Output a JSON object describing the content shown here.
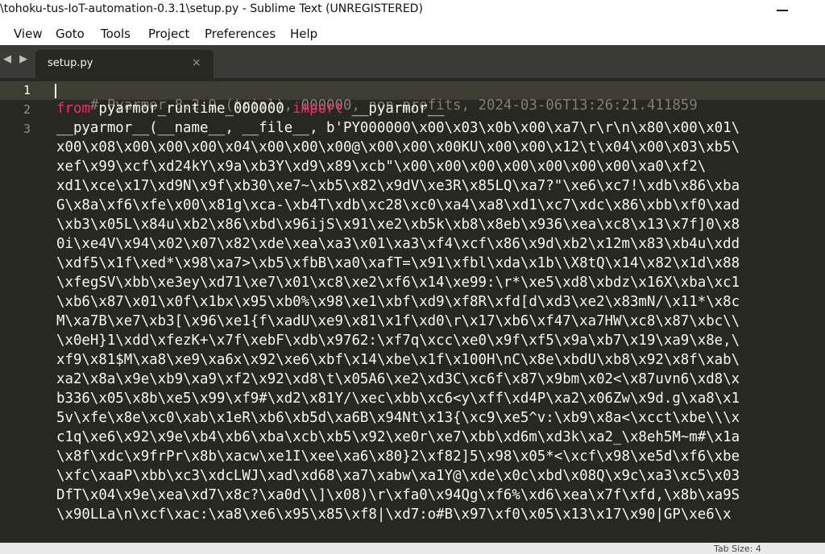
{
  "window": {
    "title": "\\tohoku-tus-IoT-automation-0.3.1\\setup.py - Sublime Text (UNREGISTERED)",
    "minimize_icon": "minimize-icon"
  },
  "menu": [
    "View",
    "Goto",
    "Tools",
    "Project",
    "Preferences",
    "Help"
  ],
  "tabs": {
    "nav_arrows": "◀ ▶",
    "active": {
      "label": "setup.py",
      "close_glyph": "×"
    }
  },
  "editor": {
    "active_line": 1,
    "line_numbers": [
      "1",
      "2",
      "3"
    ],
    "line1_comment": "# Pyarmor 8.2.9 (trial), 000000, non-profits, 2024-03-06T13:26:21.411859",
    "line2": {
      "keyword_from": "from",
      "module": " pyarmor_runtime_000000 ",
      "keyword_import": "import",
      "name": " __pyarmor__"
    },
    "code_lines": [
      "__pyarmor__(__name__, __file__, b'PY000000\\x00\\x03\\x0b\\x00\\xa7\\r\\r\\n\\x80\\x00\\x01\\",
      "x00\\x08\\x00\\x00\\x00\\x04\\x00\\x00\\x00@\\x00\\x00\\x00KU\\x00\\x00\\x12\\t\\x04\\x00\\x03\\xb5\\",
      "xef\\x99\\xcf\\xd24kY\\x9a\\xb3Y\\xd9\\x89\\xcb\"\\x00\\x00\\x00\\x00\\x00\\x00\\x00\\xa0\\xf2\\",
      "xd1\\xce\\x17\\xd9N\\x9f\\xb30\\xe7~\\xb5\\x82\\x9dV\\xe3R\\x85LQ\\xa7?\"\\xe6\\xc7!\\xdb\\x86\\xba",
      "G\\x8a\\xf6\\xfe\\x00\\x81g\\xca-\\xb4T\\xdb\\xc28\\xc0\\xa4\\xa8\\xd1\\xc7\\xdc\\x86\\xbb\\xf0\\xad",
      "\\xb3\\x05L\\x84u\\xb2\\x86\\xbd\\x96ijS\\x91\\xe2\\xb5k\\xb8\\x8eb\\x936\\xea\\xc8\\x13\\x7f]0\\x8",
      "0i\\xe4V\\x94\\x02\\x07\\x82\\xde\\xea\\xa3\\x01\\xa3\\xf4\\xcf\\x86\\x9d\\xb2\\x12m\\x83\\xb4u\\xdd",
      "\\xdf5\\x1f\\xed*\\x98\\xa7>\\xb5\\xfbB\\xa0\\xafT=\\x91\\xfbl\\xda\\x1b\\\\X8tQ\\x14\\x82\\x1d\\x88",
      "\\xfegSV\\xbb\\xe3ey\\xd71\\xe7\\x01\\xc8\\xe2\\xf6\\x14\\xe99:\\r*\\xe5\\xd8\\xbdz\\x16X\\xba\\xc1",
      "\\xb6\\x87\\x01\\x0f\\x1bx\\x95\\xb0%\\x98\\xe1\\xbf\\xd9\\xf8R\\xfd[d\\xd3\\xe2\\x83mN/\\x11*\\x8c",
      "M\\xa7B\\xe7\\xb3[\\x96\\xe1{f\\xadU\\xe9\\x81\\x1f\\xd0\\r\\x17\\xb6\\xf47\\xa7HW\\xc8\\x87\\xbc\\\\",
      "\\x0eH}1\\xdd\\xfezK+\\x7f\\xebF\\xdb\\x9762:\\xf7q\\xcc\\xe0\\x9f\\xf5\\x9a\\xb7\\x19\\xa9\\x8e,\\",
      "xf9\\x81$M\\xa8\\xe9\\xa6x\\x92\\xe6\\xbf\\x14\\xbe\\x1f\\x100H\\nC\\x8e\\xbdU\\xb8\\x92\\x8f\\xab\\",
      "xa2\\x8a\\x9e\\xb9\\xa9\\xf2\\x92\\xd8\\t\\x05A6\\xe2\\xd3C\\xc6f\\x87\\x9bm\\x02<\\x87uvn6\\xd8\\x",
      "b336\\x05\\x8b\\xe5\\x99\\xf9#\\xd2\\x81Y/\\xec\\xbb\\xc6<y\\xff\\xd4P\\xa2\\x06Zw\\x9d.g\\xa8\\x1",
      "5v\\xfe\\x8e\\xc0\\xab\\x1eR\\xb6\\xb5d\\xa6B\\x94Nt\\x13{\\xc9\\xe5^v:\\xb9\\x8a<\\xcct\\xbe\\\\\\x",
      "c1q\\xe6\\x92\\x9e\\xb4\\xb6\\xba\\xcb\\xb5\\x92\\xe0r\\xe7\\xbb\\xd6m\\xd3k\\xa2_\\x8eh5M~m#\\x1a",
      "\\x8f\\xdc\\x9frPr\\x8b\\xacw\\xe1I\\xee\\xa6\\x80}2\\xf82]5\\x98\\x05*<\\xcf\\x98\\xe5d\\xf6\\xbe",
      "\\xfc\\xaaP\\xbb\\xc3\\xdcLWJ\\xad\\xd68\\xa7\\xabw\\xa1Y@\\xde\\x0c\\xbd\\x08Q\\x9c\\xa3\\xc5\\x03",
      "DfT\\x04\\x9e\\xea\\xd7\\x8c?\\xa0d\\\\]\\x08)\\r\\xfa0\\x94Qg\\xf6%\\xd6\\xea\\x7f\\xfd,\\x8b\\xa9S",
      "\\x90LLa\\n\\xcf\\xac:\\xa8\\xe6\\x95\\x85\\xf8|\\xd7:o#B\\x97\\xf0\\x05\\x13\\x17\\x90|GP\\xe6\\x"
    ]
  },
  "status": {
    "tab_size": "Tab Size: 4"
  },
  "colors": {
    "background": "#272822",
    "comment": "#7f7e71",
    "keyword": "#f92672",
    "text": "#f8f8f2"
  }
}
